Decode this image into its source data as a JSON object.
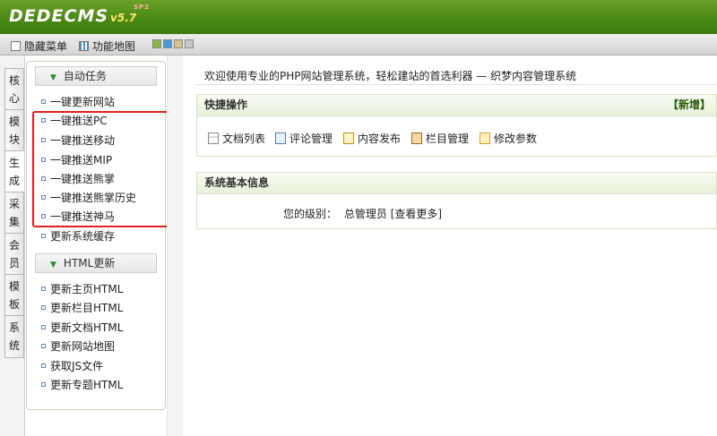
{
  "header": {
    "logo": "DEDECMS",
    "version": "v5.7",
    "version_sup": "SP2"
  },
  "menubar": {
    "hide_menu": "隐藏菜单",
    "sitemap": "功能地图"
  },
  "theme_swatches": [
    "#8ab848",
    "#4a9ad8",
    "#d8c090",
    "#c8c8c8"
  ],
  "side_tabs": [
    {
      "label": "核心"
    },
    {
      "label": "模块"
    },
    {
      "label": "生成"
    },
    {
      "label": "采集"
    },
    {
      "label": "会员"
    },
    {
      "label": "模板"
    },
    {
      "label": "系统"
    }
  ],
  "groups": [
    {
      "title": "自动任务",
      "items": [
        "一键更新网站",
        "一键推送PC",
        "一键推送移动",
        "一键推送MIP",
        "一键推送熊掌",
        "一键推送熊掌历史",
        "一键推送神马",
        "更新系统缓存"
      ]
    },
    {
      "title": "HTML更新",
      "items": [
        "更新主页HTML",
        "更新栏目HTML",
        "更新文档HTML",
        "更新网站地图",
        "获取JS文件",
        "更新专题HTML"
      ]
    }
  ],
  "main": {
    "welcome": "欢迎使用专业的PHP网站管理系统，轻松建站的首选利器 — 织梦内容管理系统",
    "quick": {
      "title": "快捷操作",
      "new_label": "【新增】",
      "actions": [
        "文档列表",
        "评论管理",
        "内容发布",
        "栏目管理",
        "修改参数"
      ]
    },
    "info": {
      "title": "系统基本信息",
      "level_label": "您的级别：",
      "level_value": "总管理员",
      "more": "[查看更多]"
    }
  }
}
